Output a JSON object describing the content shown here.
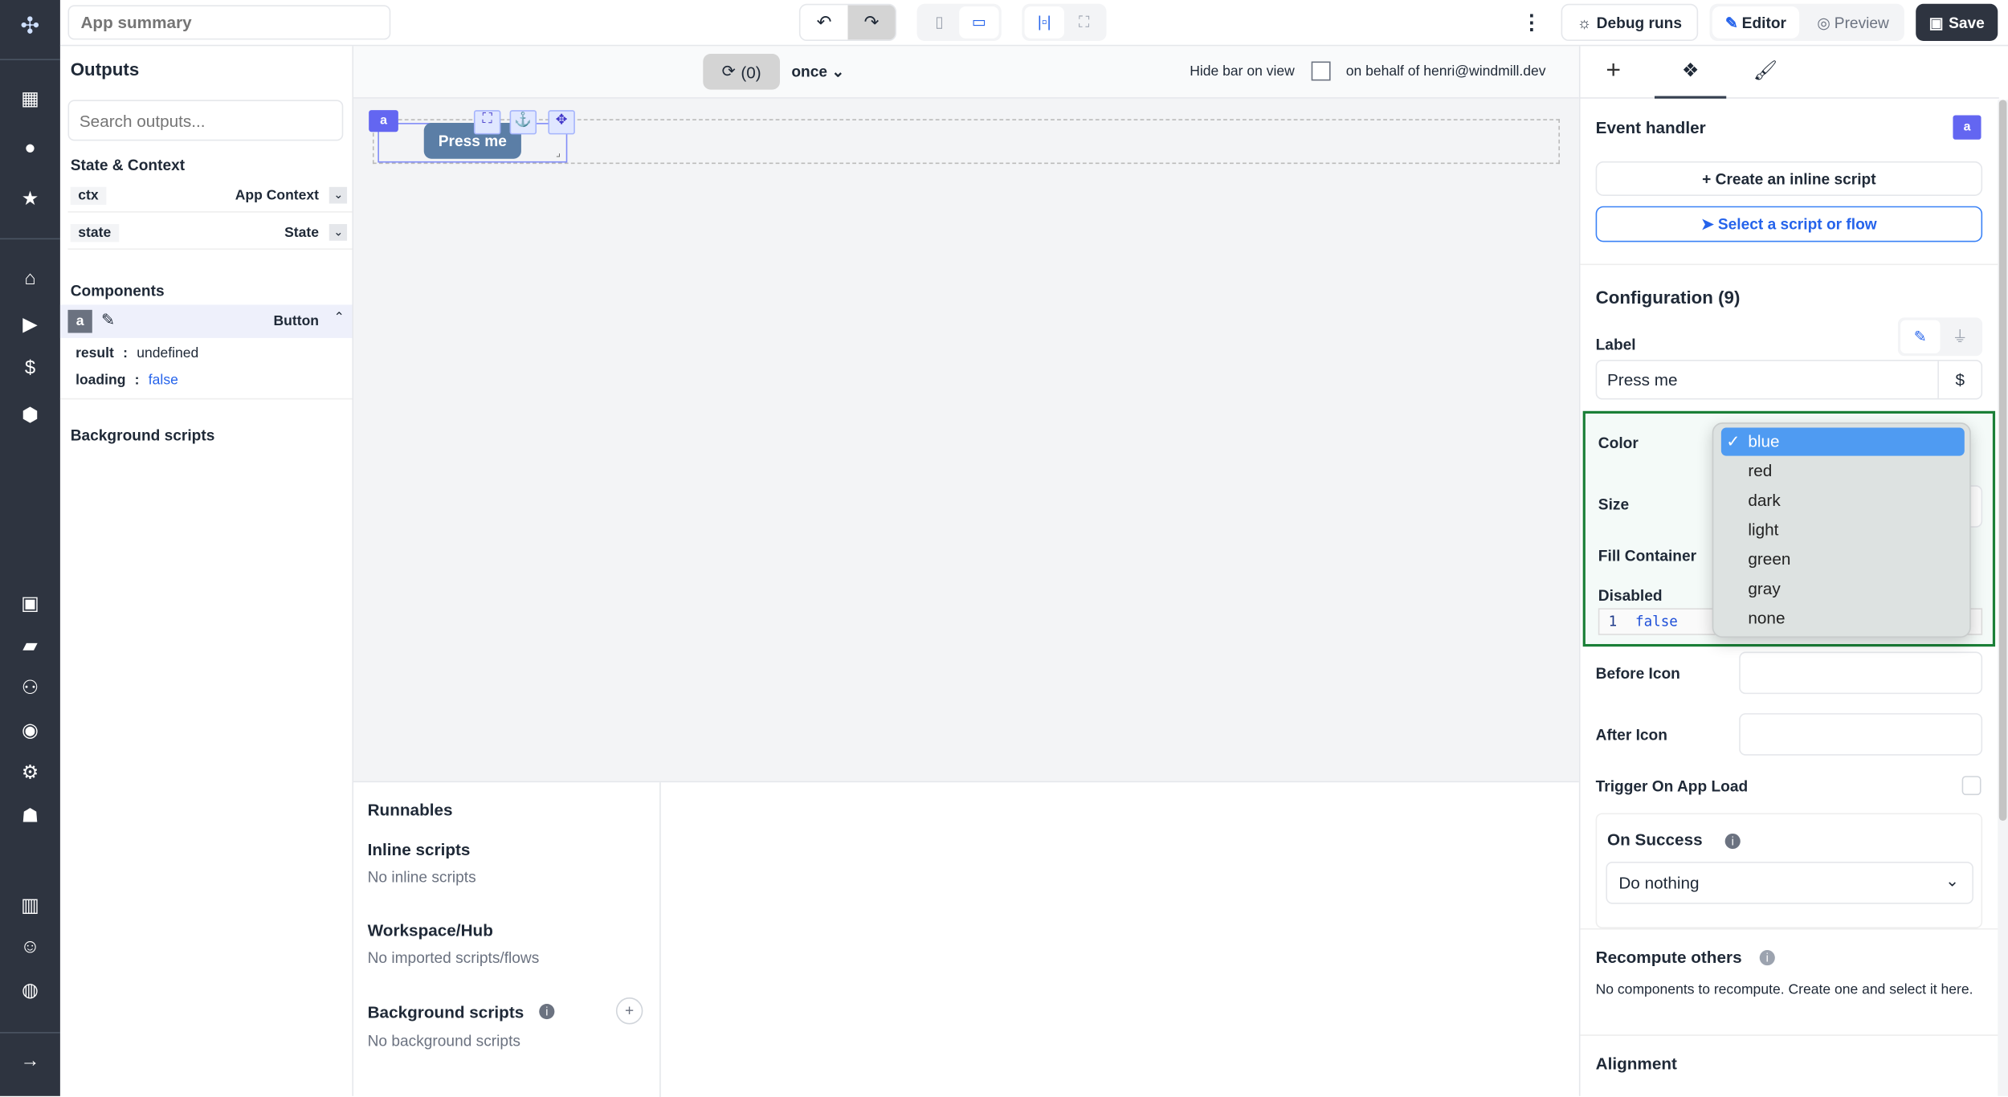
{
  "header": {
    "title_placeholder": "App summary",
    "kebab": "⋮",
    "debug_runs": "Debug runs",
    "editor": "Editor",
    "preview": "Preview",
    "save": "Save"
  },
  "sidebar": {
    "icons": [
      "windmill-logo",
      "apps-icon",
      "user-icon",
      "star-icon",
      "home-icon",
      "play-icon",
      "dollar-icon",
      "resources-icon",
      "calendar-icon",
      "folder-icon",
      "groups-icon",
      "eye-icon",
      "settings-icon",
      "bot-icon",
      "docs-icon",
      "discord-icon",
      "github-icon",
      "expand-icon"
    ]
  },
  "outputs": {
    "title": "Outputs",
    "search_placeholder": "Search outputs...",
    "state_context": "State & Context",
    "rows": [
      {
        "key": "ctx",
        "value": "App Context"
      },
      {
        "key": "state",
        "value": "State"
      }
    ],
    "components_title": "Components",
    "component": {
      "id": "a",
      "name": "Button",
      "fields": [
        {
          "key": "result",
          "sep": ":",
          "value": "undefined"
        },
        {
          "key": "loading",
          "sep": ":",
          "value": "false"
        }
      ]
    },
    "background_scripts": "Background scripts"
  },
  "canvas": {
    "refresh": "(0)",
    "once": "once",
    "hide_bar": "Hide bar on view",
    "behalf": "on behalf of henri@windmill.dev",
    "component_id": "a",
    "button_label": "Press me"
  },
  "runnables": {
    "title": "Runnables",
    "inline_title": "Inline scripts",
    "inline_empty": "No inline scripts",
    "workspace_title": "Workspace/Hub",
    "workspace_empty": "No imported scripts/flows",
    "bg_title": "Background scripts",
    "bg_empty": "No background scripts"
  },
  "panel": {
    "tabs": [
      "+",
      "components",
      "style"
    ],
    "event_handler": "Event handler",
    "badge": "a",
    "create_inline": "+ Create an inline script",
    "select_script": "Select a script or flow",
    "configuration": "Configuration (9)",
    "label_title": "Label",
    "label_value": "Press me",
    "dollar": "$",
    "color": "Color",
    "size": "Size",
    "fill_container": "Fill Container",
    "disabled": "Disabled",
    "disabled_line": "1",
    "disabled_value": "false",
    "before_icon": "Before Icon",
    "after_icon": "After Icon",
    "trigger": "Trigger On App Load",
    "on_success": "On Success",
    "on_success_value": "Do nothing",
    "recompute": "Recompute others",
    "recompute_text": "No components to recompute. Create one and select it here.",
    "alignment": "Alignment"
  },
  "color_dropdown": {
    "selected": "blue",
    "options": [
      "blue",
      "red",
      "dark",
      "light",
      "green",
      "gray",
      "none"
    ]
  },
  "colors": {
    "sidebar": "#2e3440",
    "accent": "#6366f1",
    "button": "#5b7ea6",
    "highlight": "#1a7f37",
    "selected_option": "#4f9bf2"
  }
}
